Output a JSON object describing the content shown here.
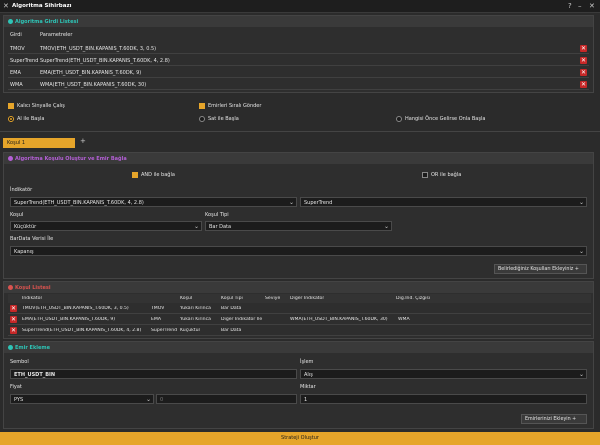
{
  "window": {
    "title": "Algoritma Sihirbazı"
  },
  "indicators": {
    "title": "Algoritma Girdi Listesi",
    "col_input": "Girdi",
    "col_params": "Parametreler",
    "rows": [
      {
        "name": "TMOV",
        "params": "TMOV(ETH_USDT_BIN.KAPANIS_T.60DK, 3, 0.5)"
      },
      {
        "name": "SuperTrend",
        "params": "SuperTrend(ETH_USDT_BIN.KAPANIS_T.60DK, 4, 2.8)"
      },
      {
        "name": "EMA",
        "params": "EMA(ETH_USDT_BIN.KAPANIS_T.60DK, 9)"
      },
      {
        "name": "WMA",
        "params": "WMA(ETH_USDT_BIN.KAPANIS_T.60DK, 30)"
      }
    ]
  },
  "options": {
    "continuous_signal": "Kalıcı Sinyalle Çalış",
    "ordered_orders": "Emirleri Sıralı Gönder",
    "radio_buy": "Al ile Başla",
    "radio_sell": "Sat ile Başla",
    "radio_any": "Hangisi Önce Gelirse Onla Başla"
  },
  "tabs": {
    "active": "Koşul 1",
    "add": "+"
  },
  "condition": {
    "title": "Algoritma Koşulu Oluştur ve Emir Bağla",
    "and_label": "AND ile bağla",
    "or_label": "OR ile bağla",
    "indicator_label": "İndikatör",
    "indicator_value": "SuperTrend(ETH_USDT_BIN.KAPANIS_T.60DK, 4, 2.8)",
    "indicator_second": "SuperTrend",
    "condition_label": "Koşul",
    "condition_value": "Küçüktür",
    "condition_type_label": "Koşul Tipi",
    "condition_type_value": "Bar Data",
    "bar_label": "BarData Verisi İle",
    "bar_value": "Kapanış",
    "add_button": "Belirlediğiniz Koşulları Ekleyiniz +"
  },
  "condition_list": {
    "title": "Koşul Listesi",
    "headers": [
      "İndikatör",
      "",
      "Koşul",
      "Koşul Tipi",
      "Seviye",
      "Diğer İndikatör",
      "",
      "Diğ.İnd. Çizgisi"
    ],
    "rows": [
      [
        "TMOV(ETH_USDT_BIN.KAPANIS_T.60DK, 3, 0.5)",
        "TMOV",
        "Yukarı Kırınca",
        "Bar Data",
        "",
        "",
        "",
        ""
      ],
      [
        "EMA(ETH_USDT_BIN.KAPANIS_T.60DK, 9)",
        "EMA",
        "Yukarı Kırınca",
        "Diğer İndikatör İle",
        "",
        "WMA(ETH_USDT_BIN.KAPANIS_T.60DK, 30)",
        "WMA",
        ""
      ],
      [
        "SuperTrend(ETH_USDT_BIN.KAPANIS_T.60DK, 4, 2.8)",
        "SuperTrend",
        "Küçüktür",
        "Bar Data",
        "",
        "",
        "",
        ""
      ]
    ]
  },
  "order": {
    "title": "Emir Ekleme",
    "symbol_label": "Sembol",
    "symbol_value": "ETH_USDT_BIN",
    "action_label": "İşlem",
    "action_value": "Alış",
    "price_label": "Fiyat",
    "price_value": "PYS",
    "price_extra": "0",
    "qty_label": "Miktar",
    "qty_value": "1",
    "add_button": "Emirlerinizi Ekleyin +"
  },
  "footer": {
    "create": "Strateji Oluştur"
  },
  "colors": {
    "accent": "#e6a52a",
    "teal": "#2ec4b6",
    "purple": "#b45fd6",
    "red": "#d9534f"
  }
}
